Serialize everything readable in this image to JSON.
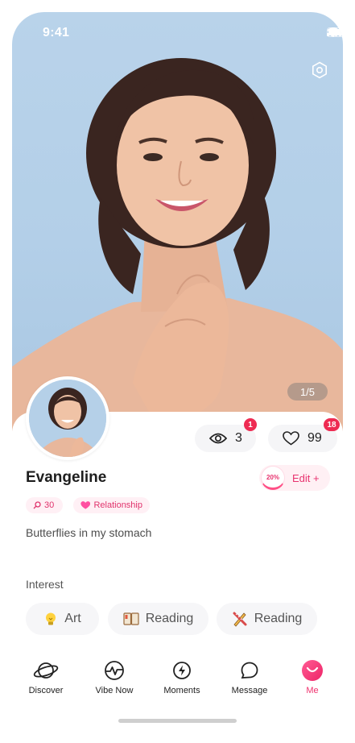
{
  "status_bar": {
    "time": "9:41"
  },
  "photo": {
    "counter": "1/5"
  },
  "profile": {
    "name": "Evangeline",
    "views": "3",
    "views_badge": "1",
    "likes": "99",
    "likes_badge": "18",
    "edit": {
      "progress": "20%",
      "progress_value": 0.2,
      "label": "Edit +"
    },
    "tags": {
      "age": "30",
      "relationship": "Relationship"
    },
    "bio": "Butterflies in my stomach"
  },
  "interest": {
    "title": "Interest",
    "items": [
      {
        "label": "Art",
        "icon": "lightbulb-icon"
      },
      {
        "label": "Reading",
        "icon": "book-icon"
      },
      {
        "label": "Reading",
        "icon": "pencil-ruler-icon"
      }
    ]
  },
  "nav": {
    "items": [
      {
        "label": "Discover",
        "icon": "planet-icon"
      },
      {
        "label": "Vibe Now",
        "icon": "pulse-icon"
      },
      {
        "label": "Moments",
        "icon": "lightning-icon"
      },
      {
        "label": "Message",
        "icon": "chat-bubble-icon"
      },
      {
        "label": "Me",
        "icon": "smile-icon",
        "active": true
      }
    ]
  },
  "colors": {
    "accent": "#f0336f",
    "badge": "#ee2b52",
    "photo_bg": "#b5d0e8"
  }
}
